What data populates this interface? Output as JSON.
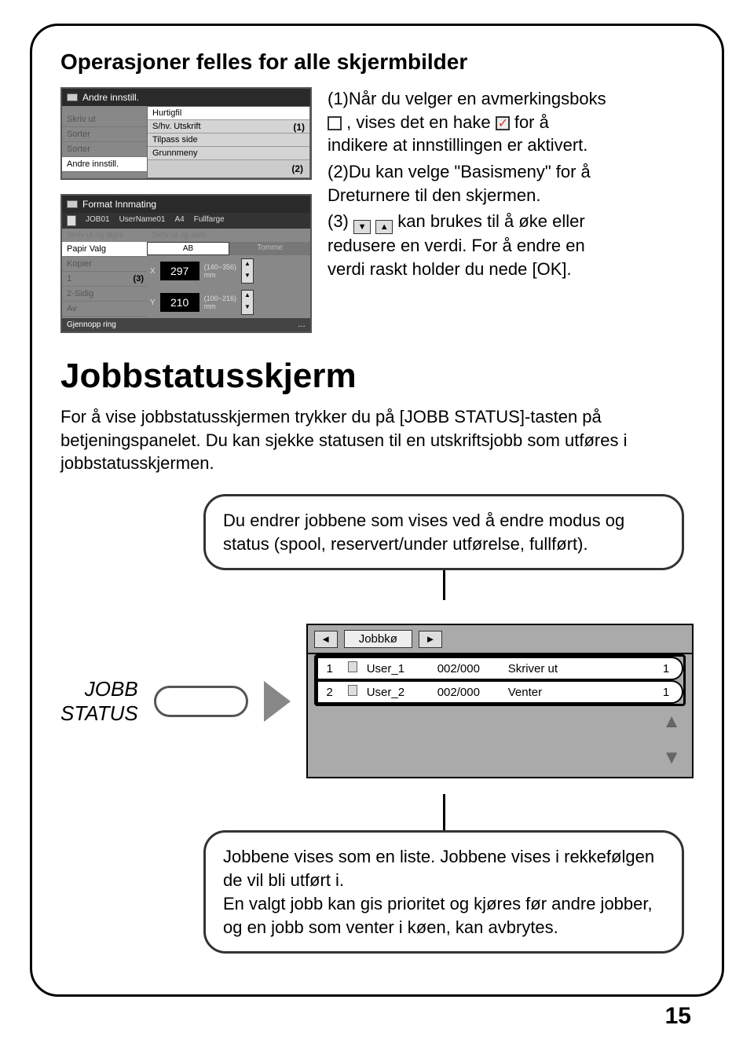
{
  "page_number": "15",
  "title": "Operasjoner felles for alle skjermbilder",
  "panel1": {
    "header": "Andre innstill.",
    "sidebar": [
      "Skriv ut",
      "Sorter",
      "Sorter",
      "Andre innstill."
    ],
    "menu": [
      "Hurtigfil",
      "S/hv. Utskrift",
      "Tilpass side",
      "Grunnmeny"
    ],
    "callout1": "(1)",
    "callout2": "(2)"
  },
  "panel2": {
    "header": "Format Innmating",
    "row": {
      "job": "JOB01",
      "user": "UserName01",
      "size": "A4",
      "mode": "Fullfarge"
    },
    "greyrows": [
      "Skriv ut og lagre",
      "Skriv ut og slett"
    ],
    "select_label": "Papir Valg",
    "tabs": [
      "AB",
      "Tomme"
    ],
    "sidebar2": [
      "Kopier",
      "1",
      "2-Sidig",
      "Av"
    ],
    "callout3": "(3)",
    "width": "297",
    "width_range": "(140~356)\nmm",
    "height": "210",
    "height_range": "(100~216)\nmm",
    "footer": "Gjennopp ring"
  },
  "instructions": {
    "p1a": "(1)Når du velger en avmerkingsboks",
    "p1b": ", vises det en hake",
    "p1c": " for å",
    "p1d": "indikere at innstillingen er aktivert.",
    "p2a": "(2)Du kan velge \"Basismeny\" for å",
    "p2b": "Dreturnere til den skjermen.",
    "p3a": "(3)",
    "p3b": " kan brukes til å øke eller",
    "p3c": "redusere en verdi. For å endre en",
    "p3d": "verdi raskt holder du nede [OK]."
  },
  "section2": {
    "heading": "Jobbstatusskjerm",
    "body": "For å vise jobbstatusskjermen trykker du på [JOBB STATUS]-tasten på betjeningspanelet. Du kan sjekke statusen til en utskriftsjobb som utføres i jobbstatusskjermen.",
    "callout_top": "Du endrer jobbene som vises ved å endre modus og status (spool, reservert/under utførelse, fullført).",
    "jobbstatus_label1": "JOBB",
    "jobbstatus_label2": "STATUS",
    "tab_label": "Jobbkø",
    "jobs": [
      {
        "n": "1",
        "name": "User_1",
        "count": "002/000",
        "status": "Skriver ut",
        "end": "1"
      },
      {
        "n": "2",
        "name": "User_2",
        "count": "002/000",
        "status": "Venter",
        "end": "1"
      }
    ],
    "callout_bottom": "Jobbene vises som en liste. Jobbene vises i rekkefølgen de vil bli utført i.\nEn valgt jobb kan gis prioritet og kjøres før andre jobber, og en jobb som venter i køen, kan avbrytes."
  }
}
